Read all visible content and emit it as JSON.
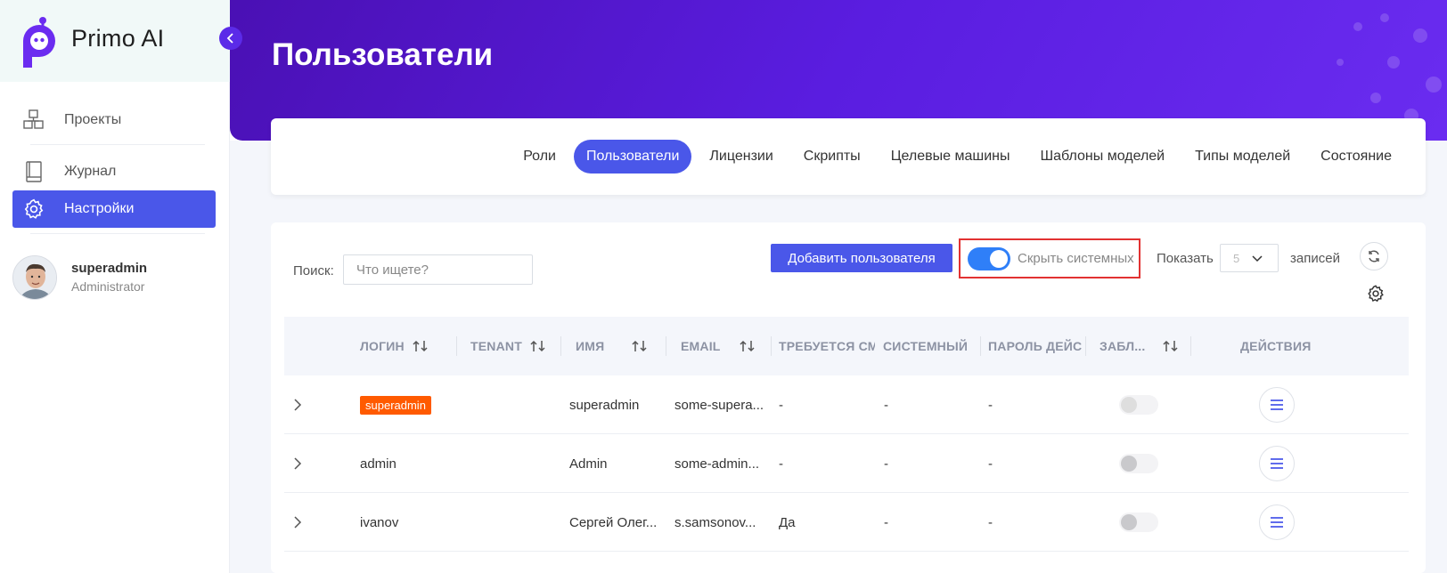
{
  "app": {
    "name": "Primo AI"
  },
  "sidebar": {
    "items": [
      {
        "label": "Проекты",
        "icon": "projects-icon"
      },
      {
        "label": "Журнал",
        "icon": "journal-icon"
      },
      {
        "label": "Настройки",
        "icon": "gear-icon",
        "active": true
      }
    ],
    "user": {
      "name": "superadmin",
      "role": "Administrator"
    }
  },
  "header": {
    "title": "Пользователи"
  },
  "tabs": [
    {
      "label": "Роли"
    },
    {
      "label": "Пользователи",
      "active": true
    },
    {
      "label": "Лицензии"
    },
    {
      "label": "Скрипты"
    },
    {
      "label": "Целевые машины"
    },
    {
      "label": "Шаблоны моделей"
    },
    {
      "label": "Типы моделей"
    },
    {
      "label": "Состояние"
    }
  ],
  "toolbar": {
    "search_label": "Поиск:",
    "search_placeholder": "Что ищете?",
    "add_button": "Добавить пользователя",
    "hide_system_label": "Скрыть системных",
    "hide_system_on": true,
    "show_label": "Показать",
    "page_size": "5",
    "records_label": "записей"
  },
  "table": {
    "columns": [
      "ЛОГИН",
      "TENANT",
      "ИМЯ",
      "EMAIL",
      "ТРЕБУЕТСЯ СМ",
      "СИСТЕМНЫЙ",
      "ПАРОЛЬ ДЕЙС",
      "ЗАБЛ...",
      "ДЕЙСТВИЯ"
    ],
    "rows": [
      {
        "login": "superadmin",
        "login_badge": true,
        "tenant": "",
        "name": "superadmin",
        "email": "some-supera...",
        "change_required": "-",
        "system": "-",
        "password_valid": "-",
        "blocked": false,
        "blocked_disabled": true
      },
      {
        "login": "admin",
        "login_badge": false,
        "tenant": "",
        "name": "Admin",
        "email": "some-admin...",
        "change_required": "-",
        "system": "-",
        "password_valid": "-",
        "blocked": false,
        "blocked_disabled": false
      },
      {
        "login": "ivanov",
        "login_badge": false,
        "tenant": "",
        "name": "Сергей Олег...",
        "email": "s.samsonov...",
        "change_required": "Да",
        "system": "-",
        "password_valid": "-",
        "blocked": false,
        "blocked_disabled": false
      }
    ]
  },
  "colors": {
    "accent": "#4a57e9",
    "header": "#5a1de0",
    "badge": "#ff5a00",
    "toggle": "#2f7ff8",
    "highlight": "#e23232"
  }
}
